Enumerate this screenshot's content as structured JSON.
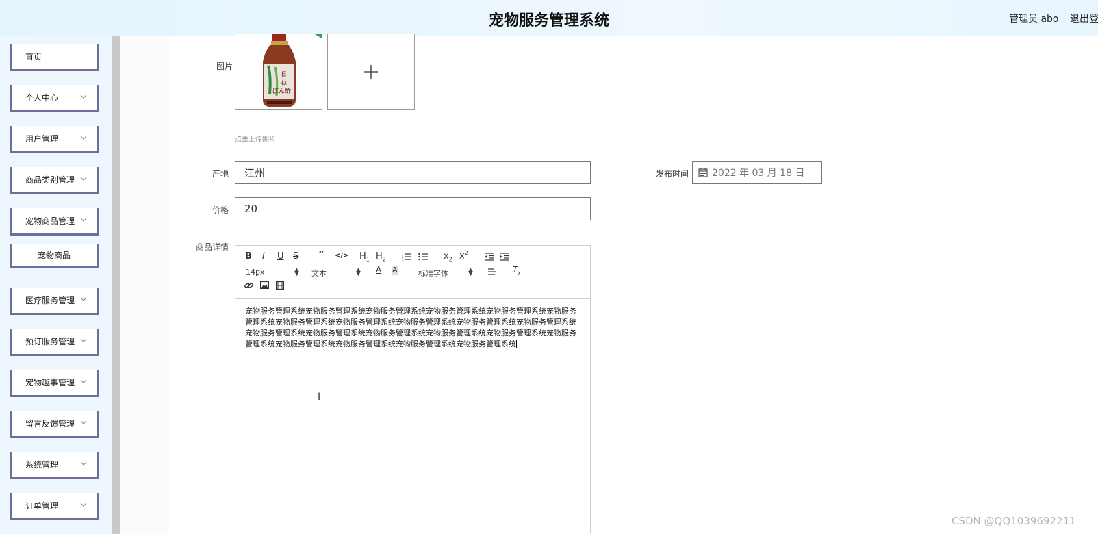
{
  "header": {
    "title": "宠物服务管理系统",
    "admin": "管理员 abo",
    "logout": "退出登"
  },
  "sidebar": {
    "items": [
      {
        "label": "首页",
        "has_chevron": false
      },
      {
        "label": "个人中心",
        "has_chevron": true
      },
      {
        "label": "用户管理",
        "has_chevron": true
      },
      {
        "label": "商品类别管理",
        "has_chevron": true
      },
      {
        "label": "宠物商品管理",
        "has_chevron": true
      },
      {
        "label": "宠物商品",
        "has_chevron": false,
        "sub": true
      },
      {
        "label": "医疗服务管理",
        "has_chevron": true
      },
      {
        "label": "预订服务管理",
        "has_chevron": true
      },
      {
        "label": "宠物趣事管理",
        "has_chevron": true
      },
      {
        "label": "留言反馈管理",
        "has_chevron": true
      },
      {
        "label": "系统管理",
        "has_chevron": true
      },
      {
        "label": "订单管理",
        "has_chevron": true
      }
    ]
  },
  "form": {
    "image_label": "图片",
    "add_icon": "plus-icon",
    "upload_hint": "点击上传图片",
    "origin_label": "产地",
    "origin_value": "江州",
    "publish_label": "发布时间",
    "publish_value": "2022 年 03 月 18 日",
    "price_label": "价格",
    "price_value": "20",
    "details_label": "商品详情"
  },
  "editor": {
    "font_size": "14px",
    "text_style": "文本",
    "font_family": "标准字体",
    "content": "宠物服务管理系统宠物服务管理系统宠物服务管理系统宠物服务管理系统宠物服务管理系统宠物服务管理系统宠物服务管理系统宠物服务管理系统宠物服务管理系统宠物服务管理系统宠物服务管理系统宠物服务管理系统宠物服务管理系统宠物服务管理系统宠物服务管理系统宠物服务管理系统宠物服务管理系统宠物服务管理系统宠物服务管理系统宠物服务管理系统宠物服务管理系统"
  },
  "watermark": "CSDN @QQ1039692211",
  "colors": {
    "menu_border": "#6f6e99",
    "header_bg": "#e4f4fd"
  }
}
